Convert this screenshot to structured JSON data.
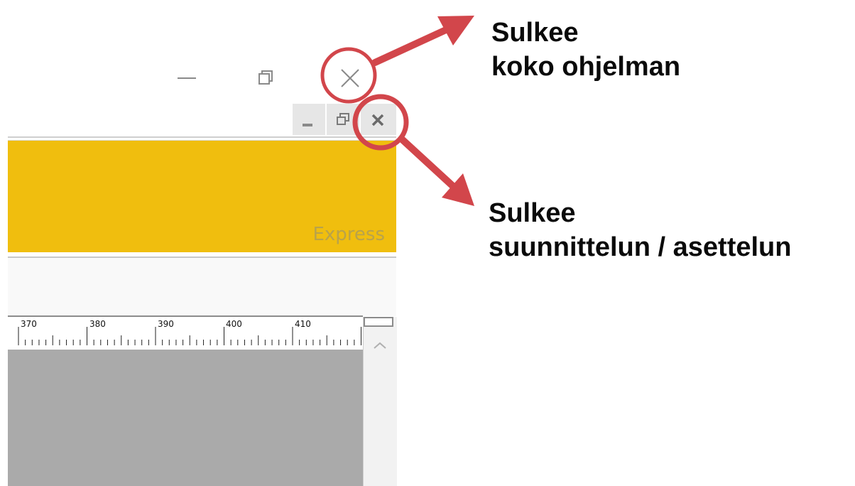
{
  "window_controls": {
    "minimize": "minimize-icon",
    "restore": "restore-icon",
    "close": "close-icon"
  },
  "mdi_controls": {
    "minimize": "minimize-icon",
    "restore": "restore-icon",
    "close": "close-icon"
  },
  "banner": {
    "text": "Express",
    "color": "#f0be0e"
  },
  "ruler": {
    "labels": [
      "370",
      "380",
      "390",
      "400",
      "410"
    ]
  },
  "annotations": {
    "top": {
      "line1": "Sulkee",
      "line2": "koko ohjelman"
    },
    "bottom": {
      "line1": "Sulkee",
      "line2": "suunnittelun / asettelun"
    },
    "highlight_color": "#d2464b"
  }
}
